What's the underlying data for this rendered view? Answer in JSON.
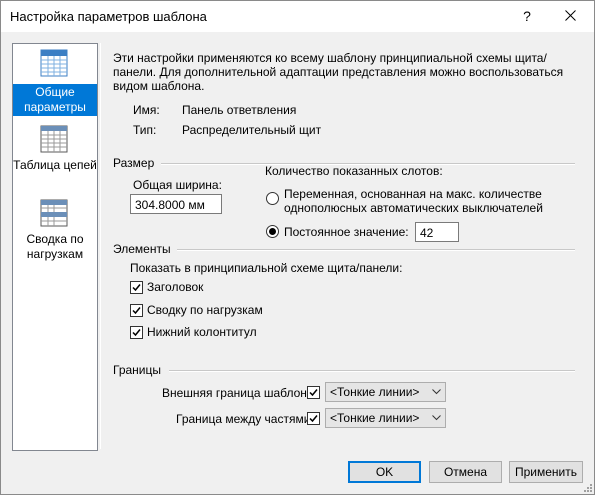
{
  "window": {
    "title": "Настройка параметров шаблона",
    "help_label": "?"
  },
  "sidebar": {
    "items": [
      {
        "label": "Общие параметры",
        "selected": true,
        "icon": "general-settings-icon"
      },
      {
        "label": "Таблица цепей",
        "selected": false,
        "icon": "circuit-table-icon"
      },
      {
        "label": "Сводка по нагрузкам",
        "selected": false,
        "icon": "load-summary-icon"
      }
    ]
  },
  "main": {
    "description": "Эти настройки применяются ко всему шаблону принципиальной схемы щита/панели. Для дополнительной адаптации представления можно воспользоваться видом шаблона.",
    "name_label": "Имя:",
    "name_value": "Панель ответвления",
    "type_label": "Тип:",
    "type_value": "Распределительный щит",
    "size": {
      "group_title": "Размер",
      "width_label": "Общая ширина:",
      "width_value": "304.8000 мм",
      "slots_label": "Количество показанных слотов:",
      "option_variable_line1": "Переменная, основанная на макс. количестве",
      "option_variable_line2": "однополюсных автоматических выключателей",
      "option_fixed": "Постоянное значение:",
      "fixed_value": "42",
      "selected_option": "fixed"
    },
    "elements": {
      "group_title": "Элементы",
      "show_label": "Показать в принципиальной схеме щита/панели:",
      "checkboxes": [
        {
          "label": "Заголовок",
          "checked": true
        },
        {
          "label": "Сводку по нагрузкам",
          "checked": true
        },
        {
          "label": "Нижний колонтитул",
          "checked": true
        }
      ]
    },
    "borders": {
      "group_title": "Границы",
      "outer_label": "Внешняя граница шаблона:",
      "outer_checked": true,
      "outer_value": "<Тонкие линии>",
      "between_label": "Граница между частями:",
      "between_checked": true,
      "between_value": "<Тонкие линии>"
    }
  },
  "footer": {
    "ok_label": "OK",
    "cancel_label": "Отмена",
    "apply_label": "Применить"
  },
  "colors": {
    "accent": "#0078d7",
    "window_bg": "#f0f0f0"
  }
}
